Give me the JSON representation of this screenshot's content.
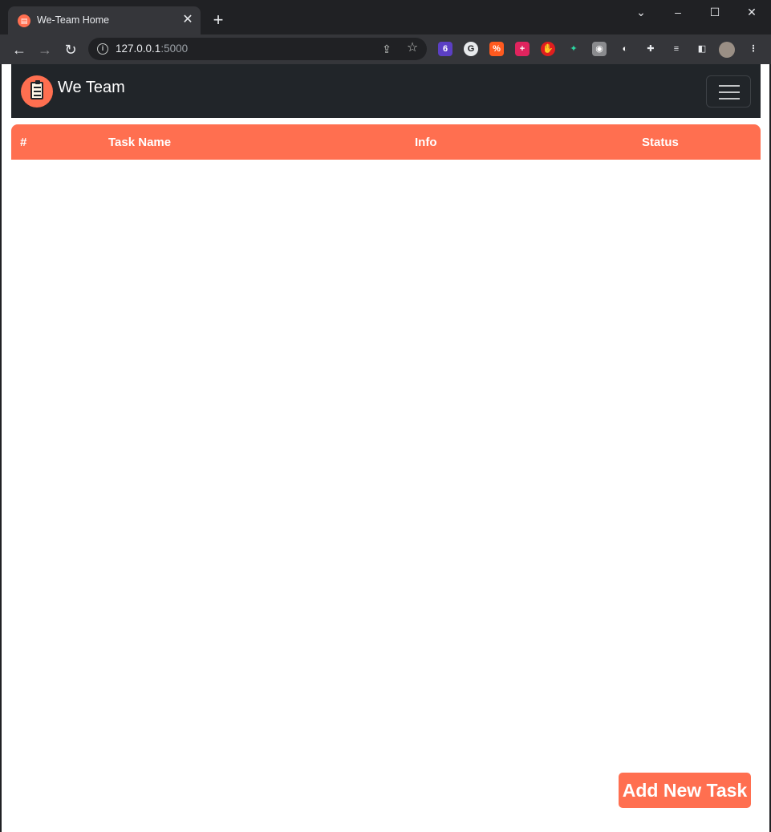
{
  "browser": {
    "tab_title": "We-Team Home",
    "tab_close": "✕",
    "new_tab": "+",
    "url_host": "127.0.0.1",
    "url_port": ":5000",
    "extensions": [
      "6"
    ],
    "window_controls": {
      "collapse": "⌄",
      "minimize": "–",
      "maximize": "☐",
      "close": "✕"
    }
  },
  "navbar": {
    "brand_name": "We Team"
  },
  "table": {
    "headers": [
      "#",
      "Task Name",
      "Info",
      "Status"
    ]
  },
  "actions": {
    "add_task_label": "Add New Task"
  },
  "colors": {
    "accent": "#ff6f50",
    "navbar_bg": "#212529",
    "page_bg": "#ffffff"
  },
  "icons": {
    "brand": "clipboard-icon",
    "menu": "hamburger-icon"
  }
}
